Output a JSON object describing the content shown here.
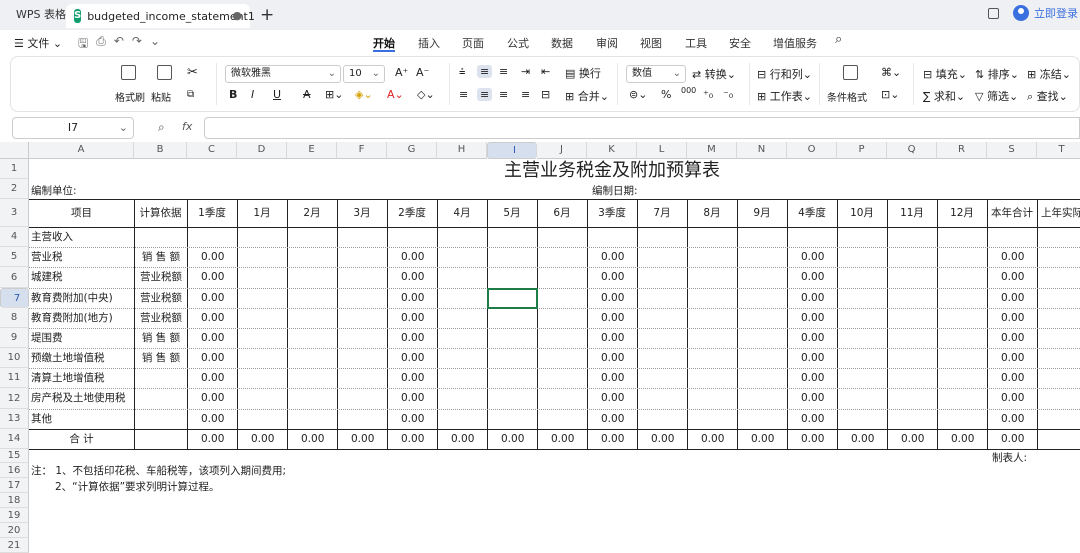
{
  "app_tab": "WPS 表格",
  "doc_tab": "budgeted_income_statement1",
  "login_label": "立即登录",
  "file_menu": "文件",
  "menu_tabs": [
    "开始",
    "插入",
    "页面",
    "公式",
    "数据",
    "审阅",
    "视图",
    "工具",
    "安全",
    "增值服务"
  ],
  "ribbon": {
    "format_painter": "格式刷",
    "paste": "粘贴",
    "font": "微软雅黑",
    "size": "10",
    "wrap": "换行",
    "merge": "合并",
    "number_format": "数值",
    "convert": "转换",
    "row_col": "行和列",
    "worksheet": "工作表",
    "cond_format": "条件格式",
    "fill": "填充",
    "sum": "求和",
    "sort": "排序",
    "filter": "筛选",
    "freeze": "冻结",
    "find": "查找",
    "bold": "B",
    "italic": "I",
    "underline": "U",
    "strike": "A",
    "percent": "%",
    "pct2": "000"
  },
  "name_box": "I7",
  "fx": "fx",
  "columns": [
    "A",
    "B",
    "C",
    "D",
    "E",
    "F",
    "G",
    "H",
    "I",
    "J",
    "K",
    "L",
    "M",
    "N",
    "O",
    "P",
    "Q",
    "R",
    "S",
    "T"
  ],
  "rows": [
    "1",
    "2",
    "3",
    "4",
    "5",
    "6",
    "7",
    "8",
    "9",
    "10",
    "11",
    "12",
    "13",
    "14",
    "15",
    "16",
    "17",
    "18",
    "19",
    "20",
    "21"
  ],
  "sheet": {
    "title": "主营业务税金及附加预算表",
    "unit_label": "编制单位:",
    "date_label": "编制日期:",
    "headers": [
      "项目",
      "计算依据",
      "1季度",
      "1月",
      "2月",
      "3月",
      "2季度",
      "4月",
      "5月",
      "6月",
      "3季度",
      "7月",
      "8月",
      "9月",
      "4季度",
      "10月",
      "11月",
      "12月",
      "本年合计",
      "上年实际"
    ],
    "items": [
      {
        "name": "主营收入",
        "basis": ""
      },
      {
        "name": "营业税",
        "basis": "销 售 额"
      },
      {
        "name": "城建税",
        "basis": "营业税额"
      },
      {
        "name": "教育费附加(中央)",
        "basis": "营业税额"
      },
      {
        "name": "教育费附加(地方)",
        "basis": "营业税额"
      },
      {
        "name": "堤围费",
        "basis": "销 售 额"
      },
      {
        "name": "预缴土地增值税",
        "basis": "销 售 额"
      },
      {
        "name": "清算土地增值税",
        "basis": ""
      },
      {
        "name": "房产税及土地使用税",
        "basis": ""
      },
      {
        "name": "其他",
        "basis": ""
      }
    ],
    "zero": "0.00",
    "total_label": "合 计",
    "maker_label": "制表人:",
    "note1": "注：  1、不包括印花税、车船税等，该项列入期间费用;",
    "note2": "2、“计算依据”要求列明计算过程。"
  }
}
